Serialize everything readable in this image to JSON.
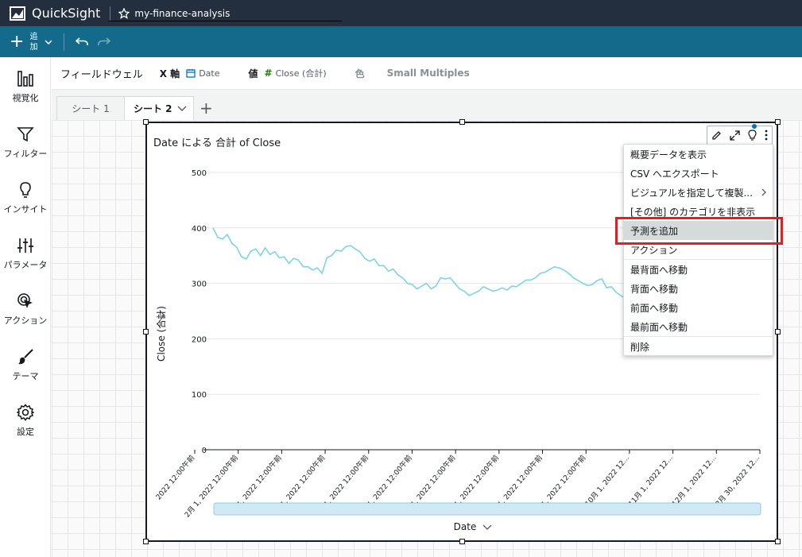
{
  "app": {
    "brand": "QuickSight",
    "analysis_name": "my-finance-analysis"
  },
  "toolbar": {
    "add_label_line1": "追",
    "add_label_line2": "加"
  },
  "sidebar": {
    "items": [
      {
        "label": "視覚化",
        "icon": "bar-chart-icon"
      },
      {
        "label": "フィルター",
        "icon": "filter-icon"
      },
      {
        "label": "インサイト",
        "icon": "lightbulb-icon"
      },
      {
        "label": "パラメータ",
        "icon": "sliders-icon"
      },
      {
        "label": "アクション",
        "icon": "cursor-click-icon"
      },
      {
        "label": "テーマ",
        "icon": "brush-icon"
      },
      {
        "label": "設定",
        "icon": "gear-icon"
      }
    ]
  },
  "fieldwells": {
    "title": "フィールドウェル",
    "x_axis_label": "X 軸",
    "x_axis_value": "Date",
    "value_label": "値",
    "value_value": "Close (合計)",
    "color_label": "色",
    "small_multiples_label": "Small Multiples"
  },
  "tabs": [
    {
      "label": "シート 1"
    },
    {
      "label": "シート 2"
    }
  ],
  "visual": {
    "title": "Date による 合計 of Close"
  },
  "chart_data": {
    "type": "line",
    "title": "Date による 合計 of Close",
    "xlabel": "Date",
    "ylabel": "Close (合計)",
    "ylim": [
      0,
      500
    ],
    "yticks": [
      0,
      100,
      200,
      300,
      400,
      500
    ],
    "xtick_labels": [
      "2022 12:00午前",
      "2月 1, 2022 12:00午前",
      "1, 2022 12:00午前",
      "1, 2022 12:00午前",
      "1, 2022 12:00午前",
      "1, 2022 12:00午前",
      "1, 2022 12:00午前",
      "1, 2022 12:00午前",
      "1, 2022 12:00午前",
      "1, 2022 12:00午前",
      "10月 1, 2022 12...",
      "11月 1, 2022 12...",
      "12月 1, 2022 12...",
      "12月 30, 2022 12..."
    ],
    "series": [
      {
        "color": "#7fd3e8",
        "values": [
          400,
          383,
          380,
          388,
          372,
          365,
          348,
          344,
          358,
          362,
          350,
          364,
          352,
          357,
          346,
          348,
          336,
          345,
          342,
          330,
          330,
          324,
          328,
          318,
          346,
          350,
          360,
          358,
          366,
          368,
          362,
          357,
          345,
          340,
          344,
          332,
          332,
          322,
          326,
          315,
          310,
          300,
          298,
          290,
          295,
          300,
          290,
          295,
          310,
          308,
          310,
          300,
          290,
          286,
          278,
          282,
          286,
          294,
          290,
          286,
          288,
          292,
          288,
          295,
          294,
          300,
          306,
          306,
          310,
          318,
          320,
          325,
          330,
          328,
          324,
          318,
          310,
          305,
          300,
          296,
          298,
          305,
          308,
          292,
          294,
          284,
          278,
          272,
          276
        ]
      }
    ],
    "grid": true
  },
  "menu": {
    "items": [
      {
        "label": "概要データを表示"
      },
      {
        "label": "CSV へエクスポート"
      },
      {
        "label": "ビジュアルを指定して複製..."
      },
      {
        "label": "[その他] のカテゴリを非表示"
      },
      {
        "label": "予測を追加"
      },
      {
        "label": "アクション"
      },
      {
        "label": "最背面へ移動"
      },
      {
        "label": "背面へ移動"
      },
      {
        "label": "前面へ移動"
      },
      {
        "label": "最前面へ移動"
      },
      {
        "label": "削除"
      }
    ]
  }
}
